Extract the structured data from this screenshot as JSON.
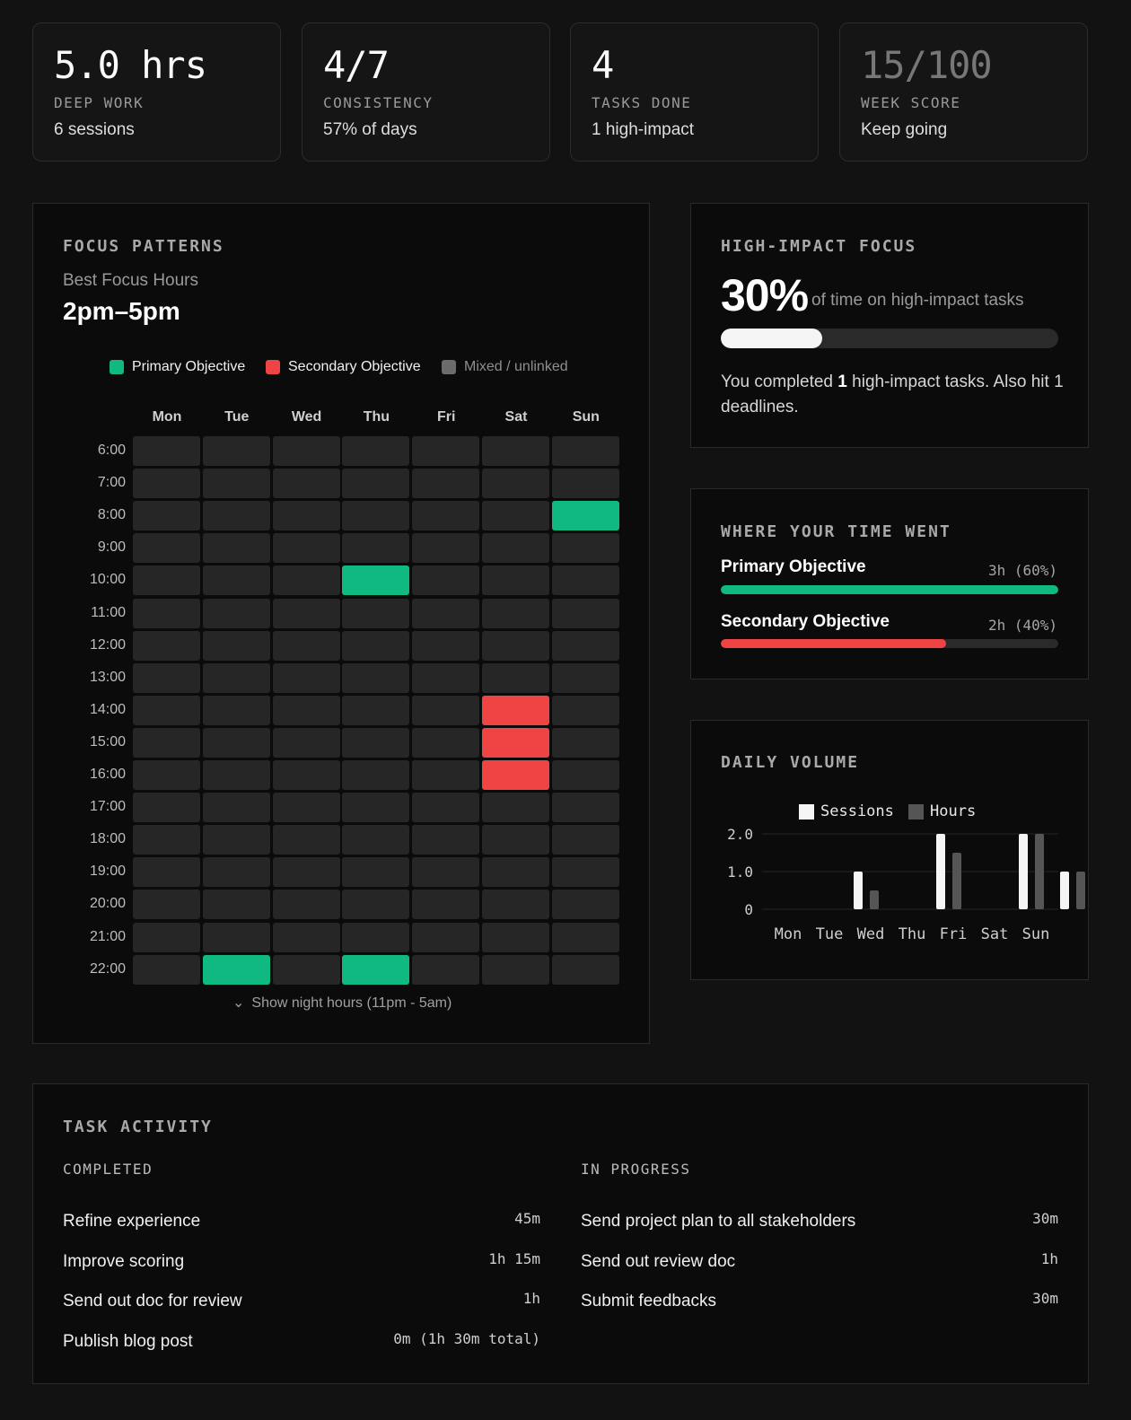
{
  "stats": [
    {
      "value": "5.0 hrs",
      "label": "DEEP WORK",
      "sub": "6 sessions"
    },
    {
      "value": "4/7",
      "label": "CONSISTENCY",
      "sub": "57% of days"
    },
    {
      "value": "4",
      "label": "TASKS DONE",
      "sub": "1 high-impact"
    },
    {
      "value": "15/100",
      "label": "WEEK SCORE",
      "sub": "Keep going"
    }
  ],
  "focus": {
    "title": "FOCUS PATTERNS",
    "best_label": "Best Focus Hours",
    "best_value": "2pm–5pm",
    "legend": [
      {
        "label": "Primary Objective",
        "color": "#10b981"
      },
      {
        "label": "Secondary Objective",
        "color": "#ef4444"
      },
      {
        "label": "Mixed / unlinked",
        "color": "#6b6b6b"
      }
    ],
    "days": [
      "Mon",
      "Tue",
      "Wed",
      "Thu",
      "Fri",
      "Sat",
      "Sun"
    ],
    "hours": [
      "6:00",
      "7:00",
      "8:00",
      "9:00",
      "10:00",
      "11:00",
      "12:00",
      "13:00",
      "14:00",
      "15:00",
      "16:00",
      "17:00",
      "18:00",
      "19:00",
      "20:00",
      "21:00",
      "22:00"
    ],
    "cells": [
      {
        "day": "Sun",
        "hour": "8:00",
        "type": "primary"
      },
      {
        "day": "Thu",
        "hour": "10:00",
        "type": "primary"
      },
      {
        "day": "Sat",
        "hour": "14:00",
        "type": "secondary"
      },
      {
        "day": "Sat",
        "hour": "15:00",
        "type": "secondary"
      },
      {
        "day": "Sat",
        "hour": "16:00",
        "type": "secondary"
      },
      {
        "day": "Tue",
        "hour": "22:00",
        "type": "primary"
      },
      {
        "day": "Thu",
        "hour": "22:00",
        "type": "primary"
      }
    ],
    "show_night": "Show night hours (11pm - 5am)"
  },
  "high_impact": {
    "title": "HIGH-IMPACT FOCUS",
    "percent": "30%",
    "percent_value": 30,
    "caption": "of time on high-impact tasks",
    "summary_pre": "You completed ",
    "summary_count": "1",
    "summary_post": " high-impact tasks. Also hit 1 deadlines."
  },
  "time_went": {
    "title": "WHERE YOUR TIME WENT",
    "items": [
      {
        "label": "Primary Objective",
        "value": "3h (60%)",
        "fraction": 1.0,
        "color": "#10b981"
      },
      {
        "label": "Secondary Objective",
        "value": "2h (40%)",
        "fraction": 0.667,
        "color": "#ef4444"
      }
    ]
  },
  "daily_volume": {
    "title": "DAILY VOLUME"
  },
  "chart_data": {
    "type": "bar",
    "categories": [
      "Mon",
      "Tue",
      "Wed",
      "Thu",
      "Fri",
      "Sat",
      "Sun"
    ],
    "series": [
      {
        "name": "Sessions",
        "values": [
          0,
          1,
          0,
          2,
          0,
          2,
          1
        ],
        "color": "#f5f5f5"
      },
      {
        "name": "Hours",
        "values": [
          0,
          0.5,
          0,
          1.5,
          0,
          2,
          1
        ],
        "color": "#555555"
      }
    ],
    "yticks": [
      "0",
      "1.0",
      "2.0"
    ],
    "ylim": [
      0,
      2
    ],
    "legend": "top"
  },
  "tasks": {
    "title": "TASK ACTIVITY",
    "completed_label": "COMPLETED",
    "in_progress_label": "IN PROGRESS",
    "completed": [
      {
        "name": "Refine experience",
        "time": "45m"
      },
      {
        "name": "Improve scoring",
        "time": "1h 15m"
      },
      {
        "name": "Send out doc for review",
        "time": "1h"
      },
      {
        "name": "Publish blog post",
        "time": "0m (1h 30m total)"
      }
    ],
    "in_progress": [
      {
        "name": "Send project plan to all stakeholders",
        "time": "30m"
      },
      {
        "name": "Send out review doc",
        "time": "1h"
      },
      {
        "name": "Submit feedbacks",
        "time": "30m"
      }
    ]
  }
}
